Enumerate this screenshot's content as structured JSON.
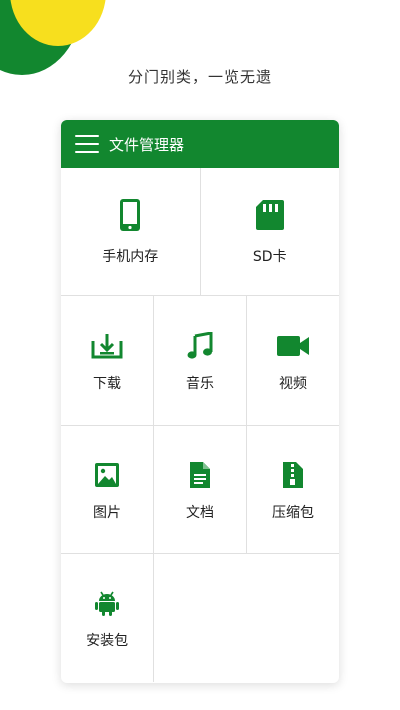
{
  "tagline": "分门别类，一览无遗",
  "colors": {
    "brand_green": "#12872f",
    "accent_yellow": "#f7df1e"
  },
  "header": {
    "title": "文件管理器",
    "menu_icon": "hamburger-menu-icon"
  },
  "grid": [
    {
      "label": "手机内存",
      "icon": "phone-icon"
    },
    {
      "label": "SD卡",
      "icon": "sd-card-icon"
    },
    {
      "label": "下载",
      "icon": "download-icon"
    },
    {
      "label": "音乐",
      "icon": "music-note-icon"
    },
    {
      "label": "视频",
      "icon": "video-camera-icon"
    },
    {
      "label": "图片",
      "icon": "image-icon"
    },
    {
      "label": "文档",
      "icon": "document-icon"
    },
    {
      "label": "压缩包",
      "icon": "archive-zip-icon"
    },
    {
      "label": "安装包",
      "icon": "android-icon"
    }
  ]
}
